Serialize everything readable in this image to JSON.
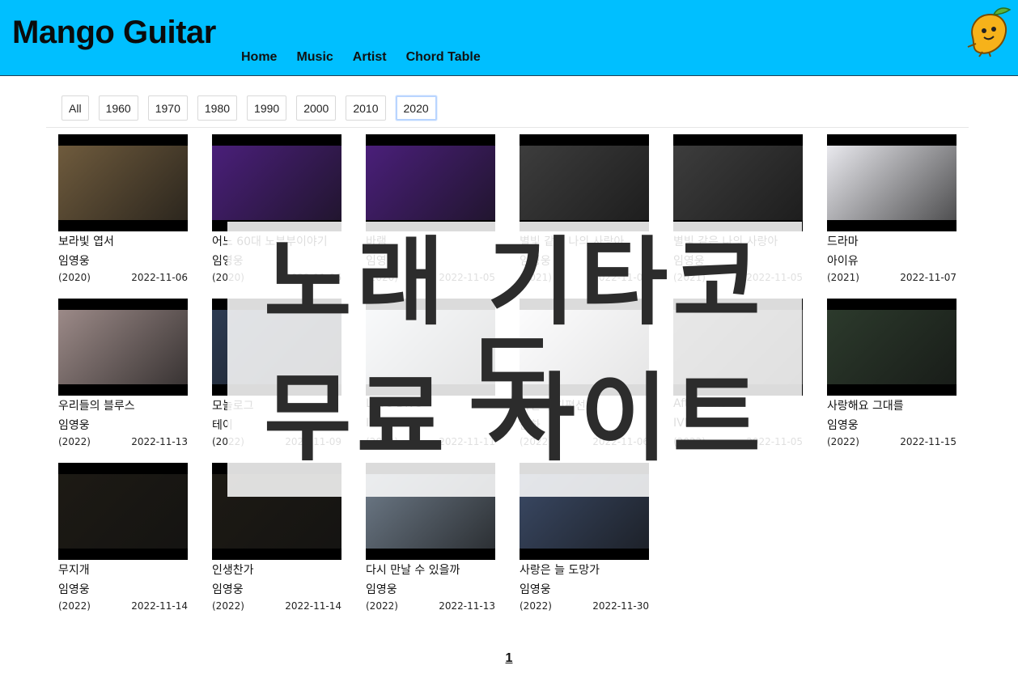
{
  "header": {
    "brand": "Mango Guitar",
    "nav": [
      "Home",
      "Music",
      "Artist",
      "Chord Table"
    ],
    "logo_icon": "mango-mascot-icon",
    "bg_color": "#00bfff"
  },
  "filters": {
    "options": [
      "All",
      "1960",
      "1970",
      "1980",
      "1990",
      "2000",
      "2010",
      "2020"
    ],
    "selected": "2020"
  },
  "songs": [
    {
      "title": "보라빛 엽서",
      "artist": "임영웅",
      "year": "(2020)",
      "date": "2022-11-06",
      "thumb_color": "#6f5b3d"
    },
    {
      "title": "어느 60대 노부부이야기",
      "artist": "임영웅",
      "year": "(2020)",
      "date": "2022-11-06",
      "thumb_color": "#4a1f7a"
    },
    {
      "title": "바램",
      "artist": "임영웅",
      "year": "(2020)",
      "date": "2022-11-05",
      "thumb_color": "#4a1f7a"
    },
    {
      "title": "별빛 같은 나의 사랑아",
      "artist": "임영웅",
      "year": "(2021)",
      "date": "2022-11-05",
      "thumb_color": "#3d3d3d"
    },
    {
      "title": "별빛 같은 나의 사랑아",
      "artist": "임영웅",
      "year": "(2021)",
      "date": "2022-11-05",
      "thumb_color": "#3d3d3d"
    },
    {
      "title": "드라마",
      "artist": "아이유",
      "year": "(2021)",
      "date": "2022-11-07",
      "thumb_color": "#e9e9ee"
    },
    {
      "title": "우리들의 블루스",
      "artist": "임영웅",
      "year": "(2022)",
      "date": "2022-11-13",
      "thumb_color": "#9c8a88"
    },
    {
      "title": "모놀로그",
      "artist": "테이",
      "year": "(2022)",
      "date": "2022-11-09",
      "thumb_color": "#2d3b52"
    },
    {
      "title": "Love Dive",
      "artist": "IVE",
      "year": "(2022)",
      "date": "2022-11-11",
      "thumb_color": "#c9d3dc"
    },
    {
      "title": "사건의 지평선",
      "artist": "윤하",
      "year": "(2022)",
      "date": "2022-11-06",
      "thumb_color": "#e3e3ea"
    },
    {
      "title": "After Like",
      "artist": "IVE",
      "year": "(2022)",
      "date": "2022-11-05",
      "thumb_color": "#5a5a5a"
    },
    {
      "title": "사랑해요 그대를",
      "artist": "임영웅",
      "year": "(2022)",
      "date": "2022-11-15",
      "thumb_color": "#2c3a2c"
    },
    {
      "title": "무지개",
      "artist": "임영웅",
      "year": "(2022)",
      "date": "2022-11-14",
      "thumb_color": "#1d1a14"
    },
    {
      "title": "인생찬가",
      "artist": "임영웅",
      "year": "(2022)",
      "date": "2022-11-14",
      "thumb_color": "#1d1a14"
    },
    {
      "title": "다시 만날 수 있을까",
      "artist": "임영웅",
      "year": "(2022)",
      "date": "2022-11-13",
      "thumb_color": "#6f7c8a"
    },
    {
      "title": "사랑은 늘 도망가",
      "artist": "임영웅",
      "year": "(2022)",
      "date": "2022-11-30",
      "thumb_color": "#3b4a66"
    }
  ],
  "overlay": {
    "line1": "노래 기타코드",
    "line2": "무료 사이트"
  },
  "pagination": {
    "current": "1"
  }
}
